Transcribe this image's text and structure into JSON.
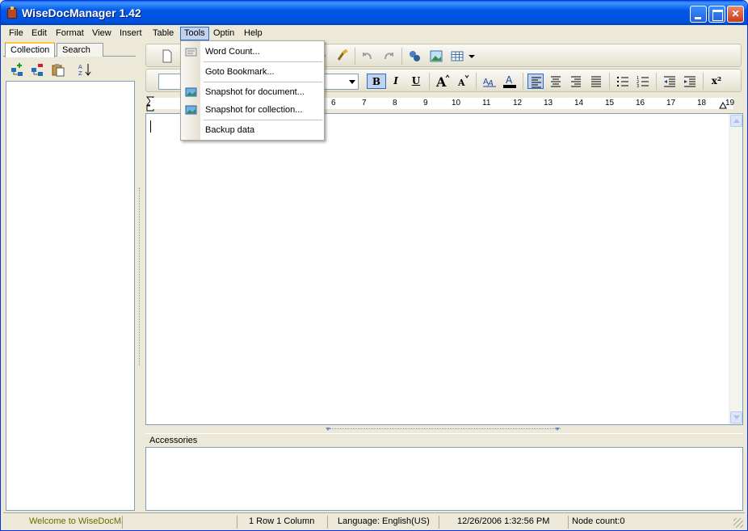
{
  "window": {
    "title": "WiseDocManager 1.42",
    "minimize": "",
    "maximize": "",
    "close": "✕"
  },
  "menu": {
    "items": [
      "File",
      "Edit",
      "Format",
      "View",
      "Insert",
      "Table",
      "Tools",
      "Optin",
      "Help"
    ],
    "active": "Tools"
  },
  "left_panel": {
    "tabs": [
      "Collection",
      "Search"
    ],
    "selected_tab": "Collection"
  },
  "toolbar2": {
    "bold": "B",
    "italic": "I",
    "underline": "U",
    "superscript": "x²"
  },
  "ruler": {
    "numbers": [
      "6",
      "7",
      "8",
      "9",
      "10",
      "11",
      "12",
      "13",
      "14",
      "15",
      "16",
      "17",
      "18",
      "19"
    ]
  },
  "accessories": {
    "title": "Accessories"
  },
  "tools_menu": {
    "items": [
      {
        "label": "Word Count...",
        "icon": "word-count-icon"
      },
      {
        "label": "Goto Bookmark...",
        "icon": ""
      },
      {
        "label": "Snapshot for document...",
        "icon": "snapshot-icon"
      },
      {
        "label": "Snapshot for collection...",
        "icon": "snapshot-icon"
      },
      {
        "label": "Backup data",
        "icon": ""
      }
    ]
  },
  "status": {
    "welcome": "Welcome to WiseDocManager",
    "position": "1 Row  1 Column",
    "language": "Language: English(US)",
    "datetime": "12/26/2006 1:32:56 PM",
    "node_count": "Node count:0"
  },
  "colors": {
    "title_blue": "#0058E6",
    "menu_highlight": "#C1D2EE",
    "status_welcome": "#6B6B00"
  }
}
